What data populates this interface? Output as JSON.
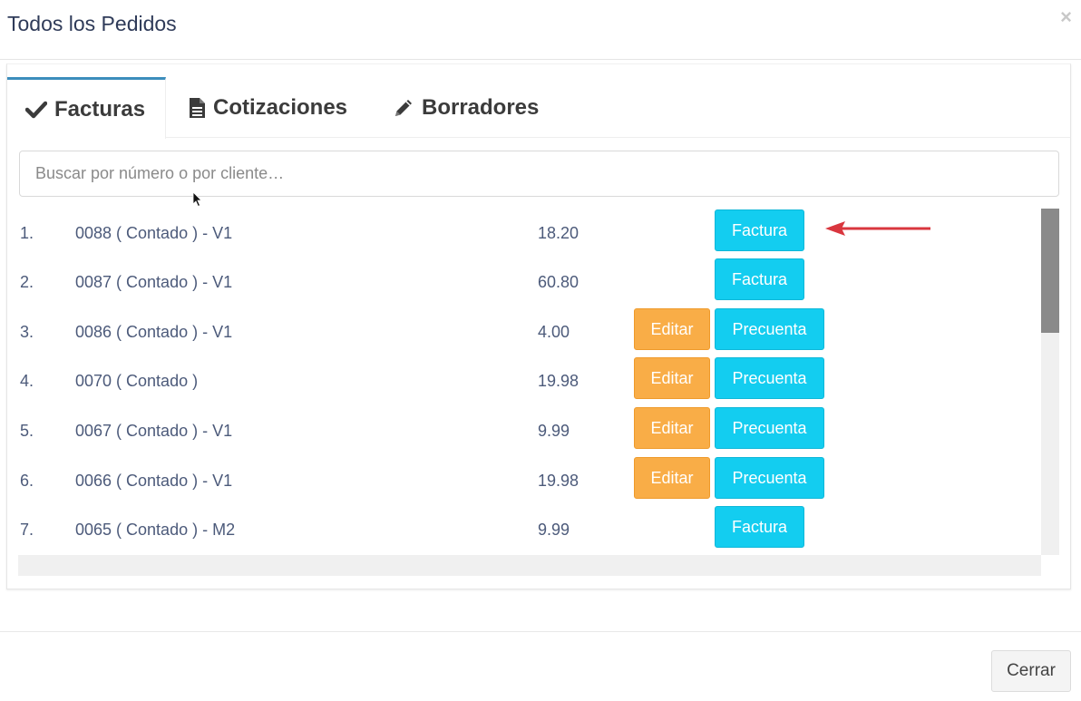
{
  "modal": {
    "title": "Todos los Pedidos",
    "close_symbol": "×"
  },
  "tabs": [
    {
      "label": "Facturas",
      "icon": "check-icon",
      "active": true
    },
    {
      "label": "Cotizaciones",
      "icon": "file-text-icon",
      "active": false
    },
    {
      "label": "Borradores",
      "icon": "pencil-icon",
      "active": false
    }
  ],
  "search": {
    "placeholder": "Buscar por número o por cliente…",
    "value": ""
  },
  "orders": [
    {
      "num": "1.",
      "name": "0088 ( Contado ) - V1",
      "amount": "18.20",
      "edit": "",
      "action": "Factura"
    },
    {
      "num": "2.",
      "name": "0087 ( Contado ) - V1",
      "amount": "60.80",
      "edit": "",
      "action": "Factura"
    },
    {
      "num": "3.",
      "name": "0086 ( Contado ) - V1",
      "amount": "4.00",
      "edit": "Editar",
      "action": "Precuenta"
    },
    {
      "num": "4.",
      "name": "0070 ( Contado )",
      "amount": "19.98",
      "edit": "Editar",
      "action": "Precuenta"
    },
    {
      "num": "5.",
      "name": "0067 ( Contado ) - V1",
      "amount": "9.99",
      "edit": "Editar",
      "action": "Precuenta"
    },
    {
      "num": "6.",
      "name": "0066 ( Contado ) - V1",
      "amount": "19.98",
      "edit": "Editar",
      "action": "Precuenta"
    },
    {
      "num": "7.",
      "name": "0065 ( Contado ) - M2",
      "amount": "9.99",
      "edit": "",
      "action": "Factura"
    }
  ],
  "footer": {
    "close_label": "Cerrar"
  },
  "colors": {
    "edit_button": "#f9ad47",
    "action_button": "#13cdf0",
    "tab_accent": "#3c8dbc",
    "annotation_arrow": "#d9363e"
  }
}
